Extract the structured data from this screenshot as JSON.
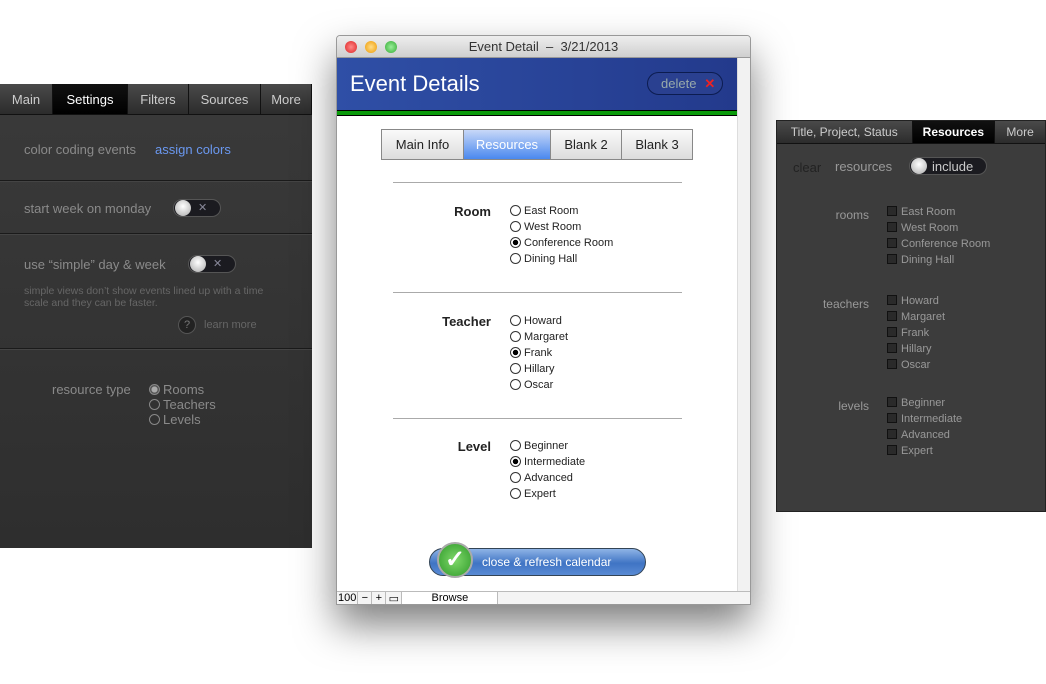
{
  "left_panel": {
    "tabs": [
      {
        "label": "Main"
      },
      {
        "label": "Settings",
        "active": true
      },
      {
        "label": "Filters"
      },
      {
        "label": "Sources"
      },
      {
        "label": "More"
      }
    ],
    "color_coding_label": "color coding events",
    "assign_colors_link": "assign colors",
    "start_week_label": "start week on monday",
    "start_week_toggle": "off",
    "simple_label": "use “simple” day & week",
    "simple_toggle": "off",
    "simple_help": "simple views don’t show events lined up with a time scale and they can be faster.",
    "learn_more": "learn more",
    "help_icon": "?",
    "toggle_x": "✕",
    "resource_type_label": "resource type",
    "resource_types": [
      {
        "label": "Rooms",
        "selected": true
      },
      {
        "label": "Teachers",
        "selected": false
      },
      {
        "label": "Levels",
        "selected": false
      }
    ]
  },
  "window": {
    "title": "Event Detail  –  3/21/2013",
    "header_title": "Event Details",
    "delete_label": "delete",
    "tabs": [
      {
        "label": "Main Info"
      },
      {
        "label": "Resources",
        "active": true
      },
      {
        "label": "Blank 2"
      },
      {
        "label": "Blank 3"
      }
    ],
    "groups": [
      {
        "label": "Room",
        "options": [
          "East Room",
          "West Room",
          "Conference Room",
          "Dining Hall"
        ],
        "selected": "Conference Room"
      },
      {
        "label": "Teacher",
        "options": [
          "Howard",
          "Margaret",
          "Frank",
          "Hillary",
          "Oscar"
        ],
        "selected": "Frank"
      },
      {
        "label": "Level",
        "options": [
          "Beginner",
          "Intermediate",
          "Advanced",
          "Expert"
        ],
        "selected": "Intermediate"
      }
    ],
    "close_button": "close & refresh calendar",
    "status": {
      "zoom": "100",
      "mode": "Browse"
    },
    "colors": {
      "header": "#2a4699",
      "accent_green": "#0a9a0a"
    }
  },
  "right_panel": {
    "tabs": [
      {
        "label": "Title, Project, Status"
      },
      {
        "label": "Resources",
        "active": true
      },
      {
        "label": "More"
      }
    ],
    "clear_label": "clear",
    "resources_label": "resources",
    "include_toggle": "include",
    "groups": [
      {
        "label": "rooms",
        "items": [
          "East Room",
          "West Room",
          "Conference Room",
          "Dining Hall"
        ]
      },
      {
        "label": "teachers",
        "items": [
          "Howard",
          "Margaret",
          "Frank",
          "Hillary",
          "Oscar"
        ]
      },
      {
        "label": "levels",
        "items": [
          "Beginner",
          "Intermediate",
          "Advanced",
          "Expert"
        ]
      }
    ]
  }
}
